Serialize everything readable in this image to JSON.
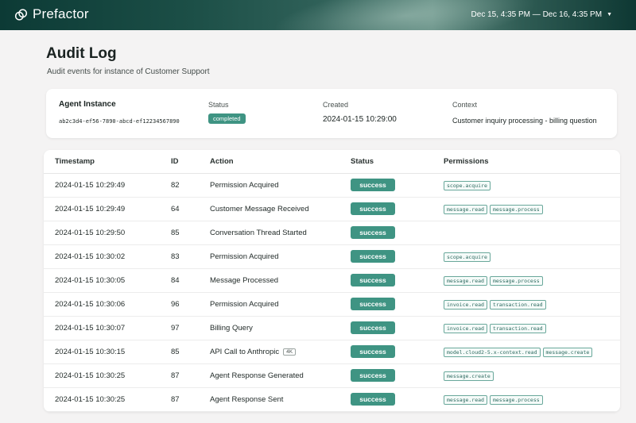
{
  "app": {
    "brand_name": "Prefactor",
    "date_range": "Dec 15, 4:35 PM — Dec 16, 4:35 PM",
    "brand_color": "#3f9483"
  },
  "page": {
    "title": "Audit Log",
    "subtitle": "Audit events for instance of Customer Support"
  },
  "instance": {
    "agent_label": "Agent Instance",
    "agent_id": "ab2c3d4-ef56-7890-abcd-ef12234567890",
    "status_label": "Status",
    "status_value": "completed",
    "created_label": "Created",
    "created_value": "2024-01-15 10:29:00",
    "context_label": "Context",
    "context_value": "Customer inquiry processing - billing question"
  },
  "table": {
    "headers": {
      "timestamp": "Timestamp",
      "id": "ID",
      "action": "Action",
      "status": "Status",
      "permissions": "Permissions"
    },
    "rows": [
      {
        "timestamp": "2024-01-15 10:29:49",
        "id": "82",
        "action": "Permission Acquired",
        "tag": "",
        "status": "success",
        "permissions": [
          "scope.acquire"
        ]
      },
      {
        "timestamp": "2024-01-15 10:29:49",
        "id": "64",
        "action": "Customer Message Received",
        "tag": "",
        "status": "success",
        "permissions": [
          "message.read",
          "message.process"
        ]
      },
      {
        "timestamp": "2024-01-15 10:29:50",
        "id": "85",
        "action": "Conversation Thread Started",
        "tag": "",
        "status": "success",
        "permissions": []
      },
      {
        "timestamp": "2024-01-15 10:30:02",
        "id": "83",
        "action": "Permission Acquired",
        "tag": "",
        "status": "success",
        "permissions": [
          "scope.acquire"
        ]
      },
      {
        "timestamp": "2024-01-15 10:30:05",
        "id": "84",
        "action": "Message Processed",
        "tag": "",
        "status": "success",
        "permissions": [
          "message.read",
          "message.process"
        ]
      },
      {
        "timestamp": "2024-01-15 10:30:06",
        "id": "96",
        "action": "Permission Acquired",
        "tag": "",
        "status": "success",
        "permissions": [
          "invoice.read",
          "transaction.read"
        ]
      },
      {
        "timestamp": "2024-01-15 10:30:07",
        "id": "97",
        "action": "Billing Query",
        "tag": "",
        "status": "success",
        "permissions": [
          "invoice.read",
          "transaction.read"
        ]
      },
      {
        "timestamp": "2024-01-15 10:30:15",
        "id": "85",
        "action": "API Call to Anthropic",
        "tag": "4K",
        "status": "success",
        "permissions": [
          "model.cloud2-5.x-context.read",
          "message.create"
        ]
      },
      {
        "timestamp": "2024-01-15 10:30:25",
        "id": "87",
        "action": "Agent Response Generated",
        "tag": "",
        "status": "success",
        "permissions": [
          "message.create"
        ]
      },
      {
        "timestamp": "2024-01-15 10:30:25",
        "id": "87",
        "action": "Agent Response Sent",
        "tag": "",
        "status": "success",
        "permissions": [
          "message.read",
          "message.process"
        ]
      }
    ]
  }
}
